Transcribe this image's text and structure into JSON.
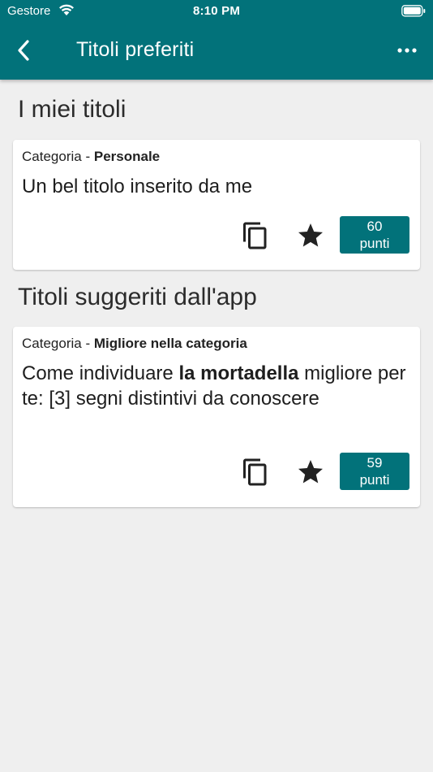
{
  "status": {
    "carrier": "Gestore",
    "time": "8:10 PM"
  },
  "nav": {
    "title": "Titoli preferiti",
    "back_icon": "chevron-left-icon",
    "more_icon": "ellipsis-icon",
    "bar_color": "#02727a"
  },
  "sections": {
    "mine": {
      "title": "I miei titoli",
      "card": {
        "category_label": "Categoria",
        "separator": "-",
        "category_value": "Personale",
        "text": "Un bel titolo inserito da me",
        "score_value": "60",
        "score_unit": "punti",
        "copy_icon": "copy-icon",
        "star_icon": "star-icon"
      }
    },
    "suggested": {
      "title": "Titoli suggeriti dall'app",
      "card": {
        "category_label": "Categoria",
        "separator": "-",
        "category_value": "Migliore nella categoria",
        "text_pre": "Come individuare ",
        "text_bold": "la mortadella",
        "text_post": " migliore per te: [3] segni distintivi da conoscere",
        "score_value": "59",
        "score_unit": "punti",
        "copy_icon": "copy-icon",
        "star_icon": "star-icon"
      }
    }
  }
}
